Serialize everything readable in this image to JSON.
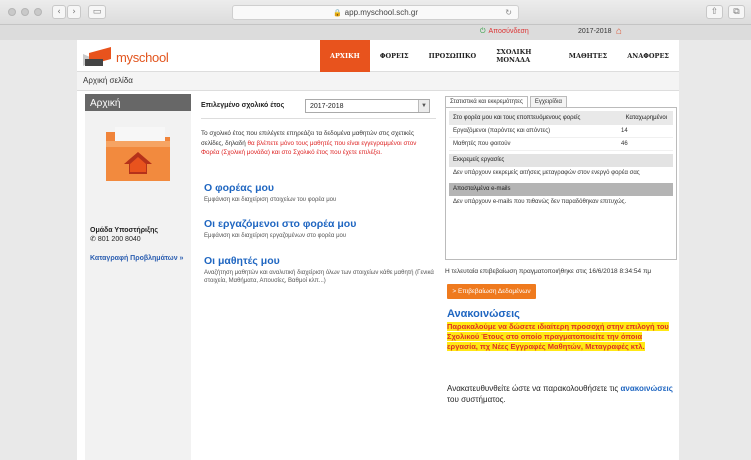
{
  "browser": {
    "url": "app.myschool.sch.gr",
    "back_icon": "chevron-left",
    "forward_icon": "chevron-right",
    "sidebar_icon": "sidebar",
    "reload_icon": "reload",
    "share_icon": "share",
    "tabs_icon": "tabs"
  },
  "userbar": {
    "logout": "Αποσύνδεση",
    "school_year": "2017-2018"
  },
  "header": {
    "logo_text": "myschool",
    "nav": [
      "ΑΡΧΙΚΗ",
      "ΦΟΡΕΙΣ",
      "ΠΡΟΣΩΠΙΚΟ",
      "ΣΧΟΛΙΚΗ ΜΟΝΑΔΑ",
      "ΜΑΘΗΤΕΣ",
      "ΑΝΑΦΟΡΕΣ"
    ],
    "active_nav": "ΑΡΧΙΚΗ",
    "accent": "#e8531d"
  },
  "breadcrumb": "Αρχική σελίδα",
  "sidebar": {
    "title": "Αρχική",
    "support_title": "Ομάδα Υποστήριξης",
    "support_phone": "801 200 8040",
    "report_link": "Καταγραφή Προβλημάτων »"
  },
  "main": {
    "year_label": "Επιλεγμένο σχολικό έτος",
    "year_value": "2017-2018",
    "info_part1": "Το σχολικό έτος που επιλέγετε επηρεάζει τα δεδομένα μαθητών στις σχετικές σελίδες, δηλαδή ",
    "info_red": "θα βλέπετε μόνο τους μαθητές που είναι εγγεγραμμένοι στον Φορέα (Σχολική μονάδα) και στο Σχολικό έτος που έχετε επιλέξει.",
    "sections": [
      {
        "title": "Ο φορέας μου",
        "desc": "Εμφάνιση και διαχείριση στοιχείων του φορέα μου"
      },
      {
        "title": "Οι εργαζόμενοι στο φορέα μου",
        "desc": "Εμφάνιση και διαχείριση εργαζομένων στο φορέα μου"
      },
      {
        "title": "Οι μαθητές μου",
        "desc": "Αναζήτηση μαθητών και αναλυτική διαχείριση όλων των στοιχείων κάθε μαθητή (Γενικά στοιχεία, Μαθήματα, Απουσίες, Βαθμοί κλπ...)"
      }
    ]
  },
  "stats": {
    "tabs": [
      "Στατιστικά και εκκρεμότητες",
      "Εγχειρίδια"
    ],
    "header_left": "Στο φορέα μου και τους εποπτευόμενους φορείς",
    "header_right": "Καταχωρημένοι",
    "rows": [
      {
        "label": "Εργαζόμενοι (παρόντες και απόντες)",
        "value": "14"
      },
      {
        "label": "Μαθητές που φοιτούν",
        "value": "46"
      }
    ],
    "pending_title": "Εκκρεμείς εργασίες",
    "pending_text": "Δεν υπάρχουν εκκρεμείς αιτήσεις μεταγραφών στον ενεργό φορέα σας",
    "emails_title": "Αποσταλμένα e-mails",
    "emails_text": "Δεν υπάρχουν e-mails που πιθανώς δεν παραδόθηκαν επιτυχώς."
  },
  "confirm": {
    "last_text": "Η τελευταία επιβεβαίωση πραγματοποιήθηκε στις 16/6/2018 8:34:54 πμ",
    "button": "> Επιβεβαίωση Δεδομένων",
    "button_color": "#ef7a1e"
  },
  "announcements": {
    "title": "Ανακοινώσεις",
    "highlight": "Παρακαλούμε να δώσετε ιδιαίτερη προσοχή στην επιλογή του Σχολικού Έτους στο οποίο πραγματοποιείτε την όποια εργασία, πχ Νέες Εγγραφές Μαθητών, Μεταγραφές κτλ.",
    "follow_part1": "Ανακατευθυνθείτε ώστε να παρακολουθήσετε τις ",
    "follow_link": "ανακοινώσεις",
    "follow_part2": " του συστήματος."
  }
}
